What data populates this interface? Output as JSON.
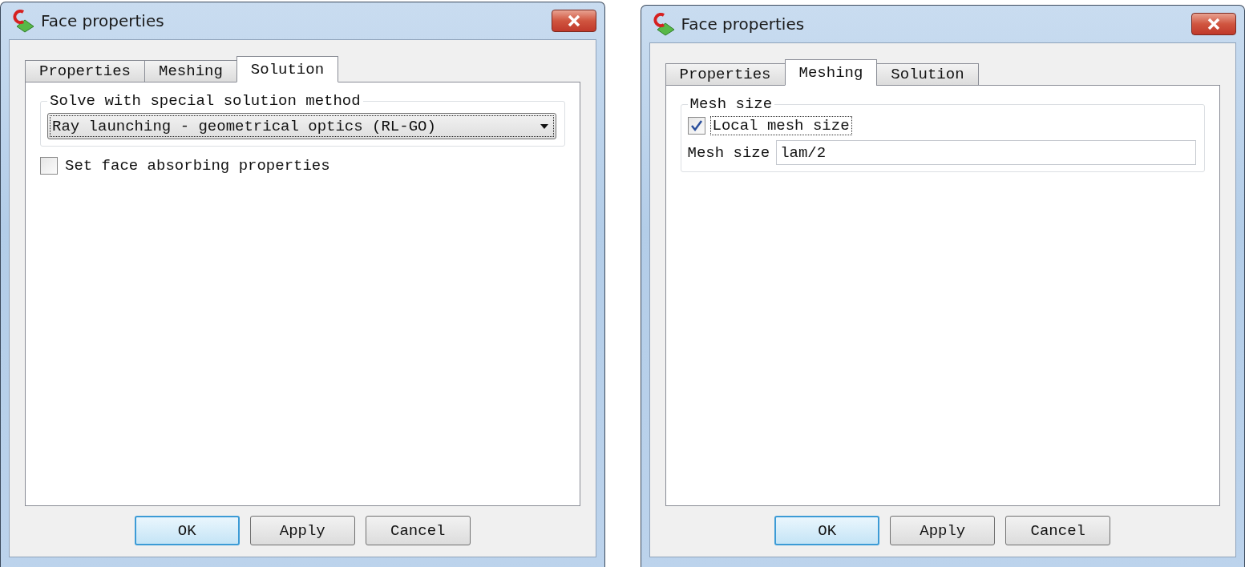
{
  "dialogs": [
    {
      "title": "Face properties",
      "tabs": [
        {
          "label": "Properties",
          "selected": false
        },
        {
          "label": "Meshing",
          "selected": false
        },
        {
          "label": "Solution",
          "selected": true
        }
      ],
      "panel": [
        {
          "kind": "group",
          "legend": "Solve with special solution method",
          "items": [
            {
              "kind": "dropdown",
              "value": "Ray launching - geometrical optics (RL-GO)"
            }
          ]
        },
        {
          "kind": "checkbox",
          "label": "Set face absorbing properties",
          "checked": false,
          "focused": false
        }
      ],
      "buttons": [
        {
          "label": "OK",
          "default": true
        },
        {
          "label": "Apply",
          "default": false
        },
        {
          "label": "Cancel",
          "default": false
        }
      ]
    },
    {
      "title": "Face properties",
      "tabs": [
        {
          "label": "Properties",
          "selected": false
        },
        {
          "label": "Meshing",
          "selected": true
        },
        {
          "label": "Solution",
          "selected": false
        }
      ],
      "panel": [
        {
          "kind": "group",
          "legend": "Mesh size",
          "items": [
            {
              "kind": "checkbox",
              "label": "Local mesh size",
              "checked": true,
              "focused": true
            },
            {
              "kind": "field",
              "label": "Mesh size",
              "value": "lam/2"
            }
          ]
        }
      ],
      "buttons": [
        {
          "label": "OK",
          "default": true
        },
        {
          "label": "Apply",
          "default": false
        },
        {
          "label": "Cancel",
          "default": false
        }
      ]
    }
  ]
}
